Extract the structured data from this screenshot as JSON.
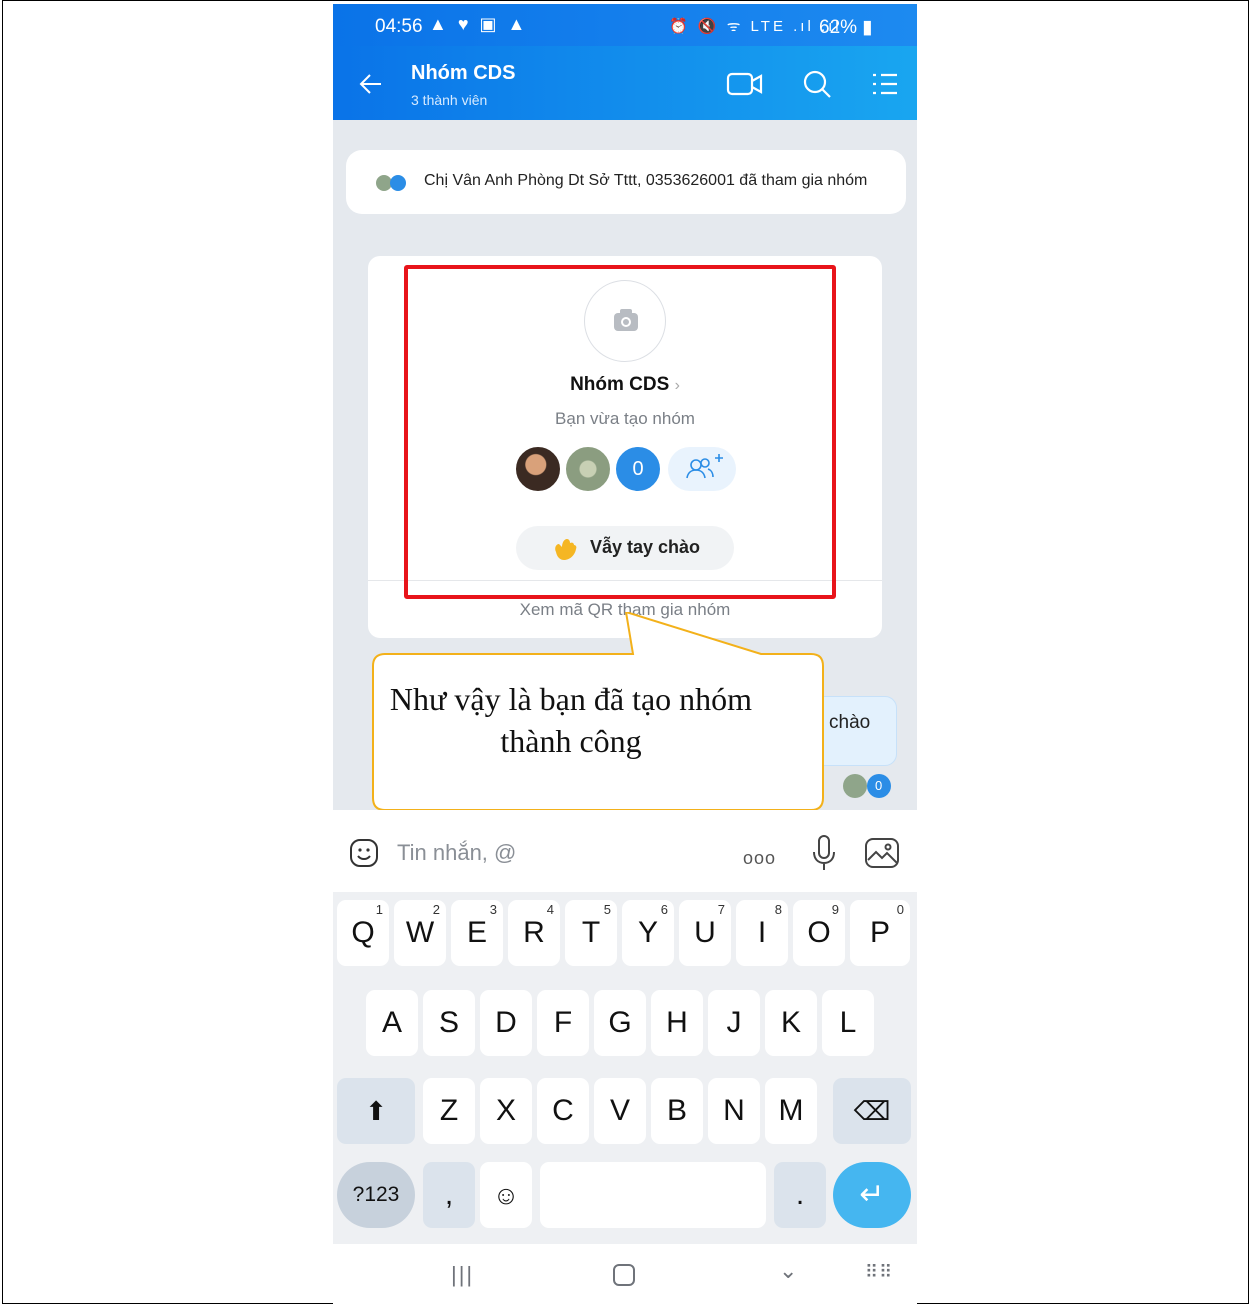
{
  "status_bar": {
    "time": "04:56",
    "left_icons": "▲ ♥ ▣ ▲",
    "right_icons": "⏰ 🔇 ᯤ LTE .ıl .ıl",
    "battery": "62%"
  },
  "header": {
    "title": "Nhóm CDS",
    "subtitle": "3 thành viên",
    "icons": [
      "back-icon",
      "video-call-icon",
      "search-icon",
      "menu-list-icon"
    ],
    "brand_color": "#0a73e8"
  },
  "chat": {
    "notice": "Chị Vân Anh Phòng Dt Sở Tttt, 0353626001 đã tham gia nhóm",
    "group_card": {
      "name": "Nhóm CDS",
      "chevron": "›",
      "subtitle": "Bạn vừa tạo nhóm",
      "member_badge": "0",
      "wave_button": "Vẫy tay chào",
      "qr_link": "Xem mã QR tham gia nhóm"
    },
    "message_partial": "chào",
    "seen_badge": "0",
    "annotation": "Như vậy là bạn đã tạo nhóm thành công",
    "highlight_color": "#e8141a"
  },
  "input": {
    "placeholder": "Tin nhắn, @",
    "more": "ooo"
  },
  "keyboard": {
    "row1": [
      {
        "key": "Q",
        "hint": "1"
      },
      {
        "key": "W",
        "hint": "2"
      },
      {
        "key": "E",
        "hint": "3"
      },
      {
        "key": "R",
        "hint": "4"
      },
      {
        "key": "T",
        "hint": "5"
      },
      {
        "key": "Y",
        "hint": "6"
      },
      {
        "key": "U",
        "hint": "7"
      },
      {
        "key": "I",
        "hint": "8"
      },
      {
        "key": "O",
        "hint": "9"
      },
      {
        "key": "P",
        "hint": "0"
      }
    ],
    "row2": [
      "A",
      "S",
      "D",
      "F",
      "G",
      "H",
      "J",
      "K",
      "L"
    ],
    "row3": [
      "Z",
      "X",
      "C",
      "V",
      "B",
      "N",
      "M"
    ],
    "sym_key": "?123",
    "comma": ",",
    "emoji_key": "☺",
    "period": ".",
    "enter_key": "↵",
    "shift_key": "⬆",
    "backspace_key": "⌫"
  },
  "nav_bar": {
    "recent": "|||",
    "back": "⌄",
    "keyboard": "⠿⠿"
  }
}
